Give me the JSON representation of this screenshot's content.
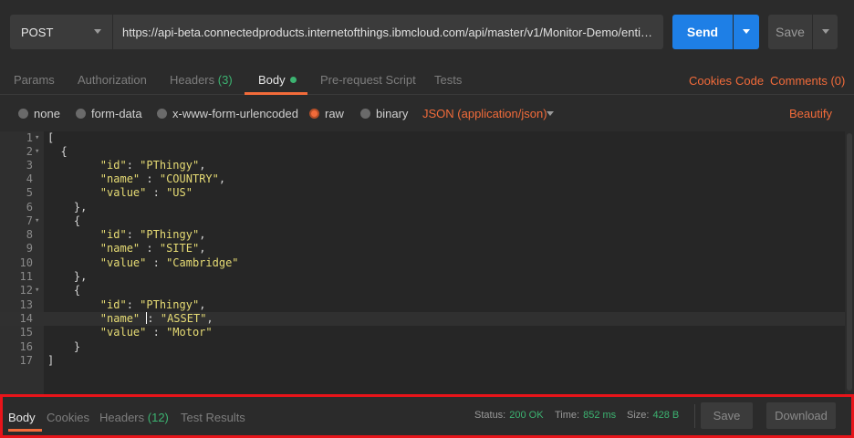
{
  "request": {
    "method": "POST",
    "url": "https://api-beta.connectedproducts.internetofthings.ibmcloud.com/api/master/v1/Monitor-Demo/entity/ty...",
    "send_label": "Send",
    "save_label": "Save"
  },
  "request_tabs": {
    "params": "Params",
    "authorization": "Authorization",
    "headers": "Headers",
    "headers_count": "(3)",
    "body": "Body",
    "prerequest": "Pre-request Script",
    "tests": "Tests",
    "cookies": "Cookies",
    "code": "Code",
    "comments": "Comments (0)"
  },
  "body_types": {
    "none": "none",
    "form_data": "form-data",
    "urlencoded": "x-www-form-urlencoded",
    "raw": "raw",
    "binary": "binary",
    "content_type": "JSON (application/json)",
    "beautify": "Beautify"
  },
  "editor": {
    "line_numbers": [
      "1",
      "2",
      "3",
      "4",
      "5",
      "6",
      "7",
      "8",
      "9",
      "10",
      "11",
      "12",
      "13",
      "14",
      "15",
      "16",
      "17"
    ]
  },
  "response": {
    "tabs": {
      "body": "Body",
      "cookies": "Cookies",
      "headers": "Headers",
      "headers_count": "(12)",
      "test_results": "Test Results"
    },
    "status_label": "Status:",
    "status_value": "200 OK",
    "time_label": "Time:",
    "time_value": "852 ms",
    "size_label": "Size:",
    "size_value": "428 B",
    "save_label": "Save",
    "download_label": "Download"
  },
  "colors": {
    "accent": "#f26b3a",
    "send": "#1e7fe6",
    "success": "#3cb371",
    "highlight_border": "#e8141a",
    "json_string": "#e6db74"
  }
}
